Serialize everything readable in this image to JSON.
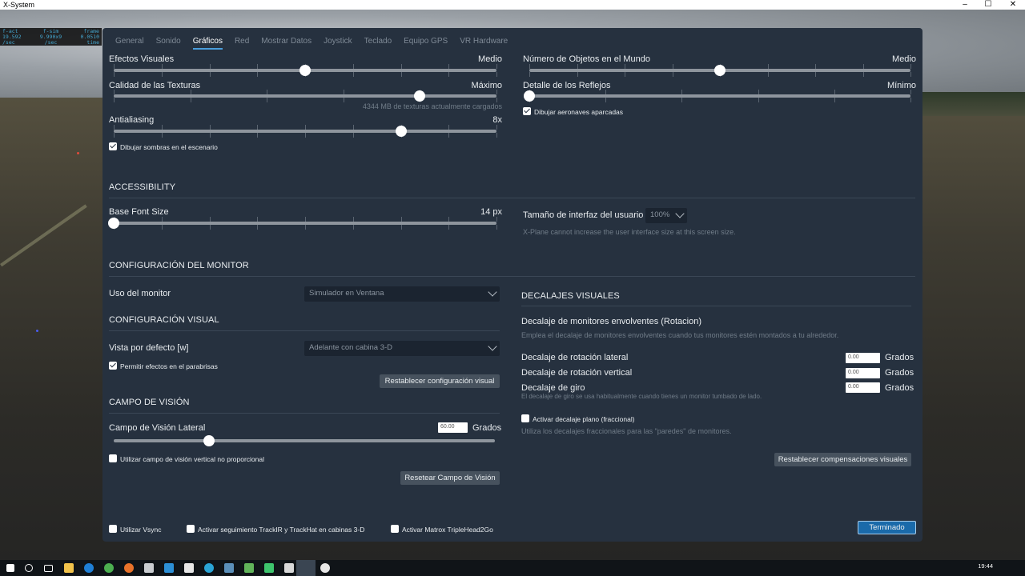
{
  "window": {
    "title": "X-System",
    "minimize": "–",
    "maximize": "☐",
    "close": "✕"
  },
  "debug": {
    "headers": [
      "f-act",
      "f-sim",
      "frame"
    ],
    "values": [
      "19.592",
      "9.990x9",
      "0.0510"
    ],
    "units": [
      "/sec",
      "/sec",
      "time"
    ]
  },
  "tabs": [
    "General",
    "Sonido",
    "Gráficos",
    "Red",
    "Mostrar Datos",
    "Joystick",
    "Teclado",
    "Equipo GPS",
    "VR Hardware"
  ],
  "active_tab": "Gráficos",
  "graphics": {
    "visual_effects": {
      "label": "Efectos Visuales",
      "value": "Medio",
      "fraction": 0.5
    },
    "texture_quality": {
      "label": "Calidad de las Texturas",
      "value": "Máximo",
      "fraction": 0.8,
      "note": "4344 MB de texturas actualmente cargados"
    },
    "antialiasing": {
      "label": "Antialiasing",
      "value": "8x",
      "fraction": 0.75
    },
    "draw_shadows": {
      "label": "Dibujar sombras en el escenario",
      "checked": true
    },
    "world_objects": {
      "label": "Número de Objetos en el Mundo",
      "value": "Medio",
      "fraction": 0.5
    },
    "reflection_detail": {
      "label": "Detalle de los Reflejos",
      "value": "Mínimo",
      "fraction": 0.0
    },
    "parked_aircraft": {
      "label": "Dibujar aeronaves aparcadas",
      "checked": true
    }
  },
  "accessibility": {
    "title": "ACCESSIBILITY",
    "base_font": {
      "label": "Base Font Size",
      "value": "14 px",
      "fraction": 0.0
    },
    "ui_size": {
      "label": "Tamaño de interfaz del usuario",
      "value": "100%",
      "note": "X-Plane cannot increase the user interface size at this screen size."
    }
  },
  "monitor": {
    "title": "CONFIGURACIÓN DEL MONITOR",
    "usage_label": "Uso del monitor",
    "usage_value": "Simulador en Ventana"
  },
  "visual": {
    "title": "CONFIGURACIÓN VISUAL",
    "default_view_label": "Vista por defecto [w]",
    "default_view_value": "Adelante con cabina 3-D",
    "windshield": {
      "label": "Permitir efectos en el parabrisas",
      "checked": true
    },
    "reset_label": "Restablecer configuración visual"
  },
  "fov": {
    "title": "CAMPO DE VISIÓN",
    "lateral_label": "Campo de Visión Lateral",
    "lateral_value": "60.00",
    "unit": "Grados",
    "fraction": 0.25,
    "nonprop": {
      "label": "Utilizar campo de visión vertical no proporcional",
      "checked": false
    },
    "reset_label": "Resetear Campo de Visión"
  },
  "offsets": {
    "title": "DECALAJES VISUALES",
    "wrap_title": "Decalaje de monitores envolventes (Rotacion)",
    "wrap_note": "Emplea el decalaje de monitores envolventes cuando tus monitores estén montados a tu alrededor.",
    "lateral": {
      "label": "Decalaje de rotación lateral",
      "value": "0.00",
      "unit": "Grados"
    },
    "vertical": {
      "label": "Decalaje de rotación vertical",
      "value": "0.00",
      "unit": "Grados"
    },
    "roll": {
      "label": "Decalaje de giro",
      "value": "0.00",
      "unit": "Grados",
      "note": "El decalaje de giro se usa habitualmente cuando tienes un monitor tumbado de lado."
    },
    "flat": {
      "label": "Activar decalaje plano (fraccional)",
      "checked": false,
      "note": "Utiliza los decalajes fraccionales para las \"paredes\" de monitores."
    },
    "reset_label": "Restablecer compensaciones visuales"
  },
  "footer": {
    "vsync": {
      "label": "Utilizar Vsync",
      "checked": false
    },
    "trackir": {
      "label": "Activar seguimiento TrackIR y TrackHat en cabinas 3-D",
      "checked": false
    },
    "matrox": {
      "label": "Activar Matrox TripleHead2Go",
      "checked": false
    },
    "done_label": "Terminado"
  },
  "taskbar": {
    "time": "19:44",
    "date": ""
  }
}
